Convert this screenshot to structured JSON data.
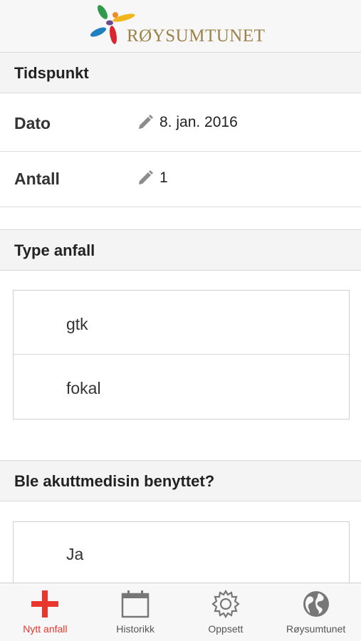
{
  "header": {
    "logo_text": "RØYSUMTUNET"
  },
  "sections": {
    "tidspunkt": {
      "title": "Tidspunkt",
      "rows": [
        {
          "label": "Dato",
          "value": "8. jan. 2016"
        },
        {
          "label": "Antall",
          "value": "1"
        }
      ]
    },
    "type_anfall": {
      "title": "Type anfall",
      "options": [
        "gtk",
        "fokal"
      ]
    },
    "akuttmedisin": {
      "title": "Ble akuttmedisin benyttet?",
      "options": [
        "Ja"
      ]
    }
  },
  "tabbar": {
    "active": "Nytt anfall",
    "tabs": [
      {
        "label": "Nytt anfall",
        "icon": "plus-icon"
      },
      {
        "label": "Historikk",
        "icon": "calendar-icon"
      },
      {
        "label": "Oppsett",
        "icon": "gear-icon"
      },
      {
        "label": "Røysumtunet",
        "icon": "globe-icon"
      }
    ]
  },
  "colors": {
    "accent": "#e8372c",
    "brand_gold": "#9a8248"
  }
}
